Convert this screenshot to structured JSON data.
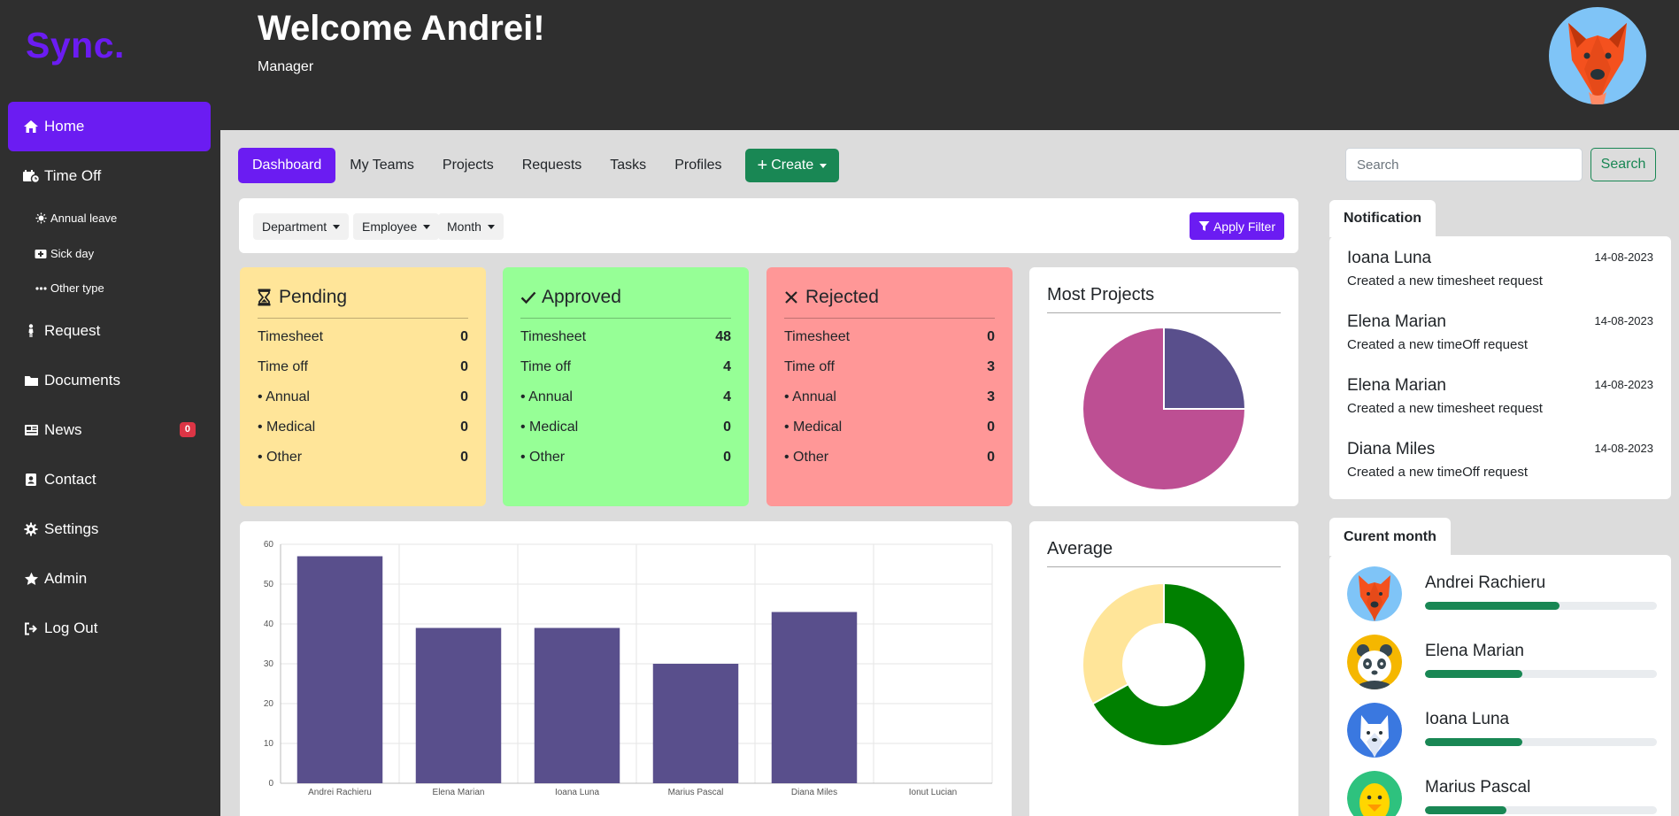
{
  "sidebar": {
    "brand": "Sync.",
    "items": [
      {
        "label": "Home"
      },
      {
        "label": "Time Off"
      },
      {
        "label": "Request"
      },
      {
        "label": "Documents"
      },
      {
        "label": "News",
        "badge": "0"
      },
      {
        "label": "Contact"
      },
      {
        "label": "Settings"
      },
      {
        "label": "Admin"
      },
      {
        "label": "Log Out"
      }
    ],
    "sub_items": [
      {
        "label": "Annual leave"
      },
      {
        "label": "Sick day"
      },
      {
        "label": "Other type"
      }
    ]
  },
  "header": {
    "welcome": "Welcome Andrei!",
    "role": "Manager"
  },
  "tabs": [
    {
      "label": "Dashboard"
    },
    {
      "label": "My Teams"
    },
    {
      "label": "Projects"
    },
    {
      "label": "Requests"
    },
    {
      "label": "Tasks"
    },
    {
      "label": "Profiles"
    }
  ],
  "create_label": "Create",
  "search": {
    "placeholder": "Search",
    "button": "Search"
  },
  "filters": {
    "department": "Department",
    "employee": "Employee",
    "month": "Month",
    "apply": "Apply Filter"
  },
  "stats": {
    "pending": {
      "title": "Pending",
      "rows": [
        {
          "label": "Timesheet",
          "value": "0"
        },
        {
          "label": "Time off",
          "value": "0"
        },
        {
          "label": "• Annual",
          "value": "0"
        },
        {
          "label": "• Medical",
          "value": "0"
        },
        {
          "label": "• Other",
          "value": "0"
        }
      ]
    },
    "approved": {
      "title": "Approved",
      "rows": [
        {
          "label": "Timesheet",
          "value": "48"
        },
        {
          "label": "Time off",
          "value": "4"
        },
        {
          "label": "• Annual",
          "value": "4"
        },
        {
          "label": "• Medical",
          "value": "0"
        },
        {
          "label": "• Other",
          "value": "0"
        }
      ]
    },
    "rejected": {
      "title": "Rejected",
      "rows": [
        {
          "label": "Timesheet",
          "value": "0"
        },
        {
          "label": "Time off",
          "value": "3"
        },
        {
          "label": "• Annual",
          "value": "3"
        },
        {
          "label": "• Medical",
          "value": "0"
        },
        {
          "label": "• Other",
          "value": "0"
        }
      ]
    }
  },
  "most_projects": {
    "title": "Most Projects"
  },
  "average": {
    "title": "Average"
  },
  "notifications": {
    "tab": "Notification",
    "items": [
      {
        "name": "Ioana Luna",
        "date": "14-08-2023",
        "desc": "Created a new timesheet request"
      },
      {
        "name": "Elena Marian",
        "date": "14-08-2023",
        "desc": "Created a new timeOff request"
      },
      {
        "name": "Elena Marian",
        "date": "14-08-2023",
        "desc": "Created a new timesheet request"
      },
      {
        "name": "Diana Miles",
        "date": "14-08-2023",
        "desc": "Created a new timeOff request"
      }
    ]
  },
  "current_month": {
    "tab": "Curent month",
    "employees": [
      {
        "name": "Andrei Rachieru",
        "progress": 0.58,
        "avatar": "fox",
        "bg": "#7fc4f7"
      },
      {
        "name": "Elena Marian",
        "progress": 0.42,
        "avatar": "panda",
        "bg": "#f5b700"
      },
      {
        "name": "Ioana Luna",
        "progress": 0.42,
        "avatar": "cat",
        "bg": "#3a78e0"
      },
      {
        "name": "Marius Pascal",
        "progress": 0.35,
        "avatar": "duck",
        "bg": "#2ec27e"
      }
    ]
  },
  "colors": {
    "accent": "#6b1cf2",
    "success": "#198754",
    "bar": "#594f8c",
    "pie_a": "#594f8c",
    "pie_b": "#bd4f93",
    "donut_a": "#008000",
    "donut_b": "#ffe599"
  },
  "chart_data": [
    {
      "type": "bar",
      "categories": [
        "Andrei Rachieru",
        "Elena Marian",
        "Ioana Luna",
        "Marius Pascal",
        "Diana Miles",
        "Ionut Lucian"
      ],
      "values": [
        57,
        39,
        39,
        30,
        43,
        0
      ],
      "ylim": [
        0,
        60
      ],
      "yticks": [
        0,
        10,
        20,
        30,
        40,
        50,
        60
      ],
      "grid": true
    },
    {
      "type": "pie",
      "values": [
        25,
        75
      ]
    },
    {
      "type": "pie",
      "donut": true,
      "values": [
        67,
        33
      ]
    }
  ]
}
